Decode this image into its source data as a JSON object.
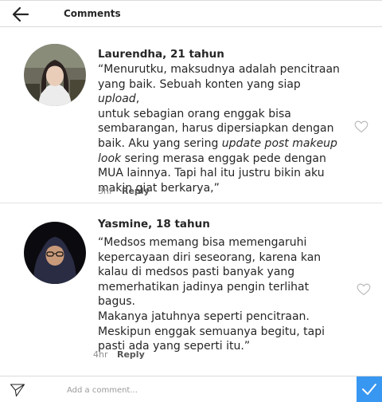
{
  "header": {
    "title": "Comments",
    "back_icon": "arrow-left-icon"
  },
  "comments": [
    {
      "author": "Laurendha, 21 tahun",
      "lines": [
        [
          "“Menurutku, maksudnya adalah pencitraan"
        ],
        [
          "yang baik. Sebuah konten yang siap ",
          {
            "i": "upload"
          },
          ","
        ],
        [
          "untuk sebagian orang enggak bisa"
        ],
        [
          "sembarangan, harus dipersiapkan dengan"
        ],
        [
          "baik. Aku yang sering ",
          {
            "i": "update post makeup"
          }
        ],
        [
          {
            "i": "look"
          },
          " sering merasa enggak pede dengan"
        ],
        [
          "MUA lainnya. Tapi hal itu justru bikin aku"
        ],
        [
          "makin giat berkarya,”"
        ]
      ],
      "time": "3hr",
      "reply_label": "Reply",
      "like_icon": "heart-outline-icon"
    },
    {
      "author": "Yasmine, 18 tahun",
      "lines": [
        [
          "“Medsos memang bisa memengaruhi"
        ],
        [
          "kepercayaan diri seseorang, karena kan"
        ],
        [
          "kalau di medsos pasti banyak yang"
        ],
        [
          "memerhatikan jadinya pengin terlihat bagus."
        ],
        [
          "Makanya jatuhnya seperti pencitraan."
        ],
        [
          "Meskipun enggak semuanya begitu, tapi"
        ],
        [
          "pasti ada yang seperti itu.”"
        ]
      ],
      "time": "4hr",
      "reply_label": "Reply",
      "like_icon": "heart-outline-icon"
    }
  ],
  "footer": {
    "placeholder": "Add a comment...",
    "send_icon": "paper-plane-icon",
    "post_icon": "checkmark-icon"
  },
  "colors": {
    "accent": "#3897f0",
    "text": "#262626",
    "muted": "#8e8e8e",
    "border": "#dbdbdb"
  }
}
